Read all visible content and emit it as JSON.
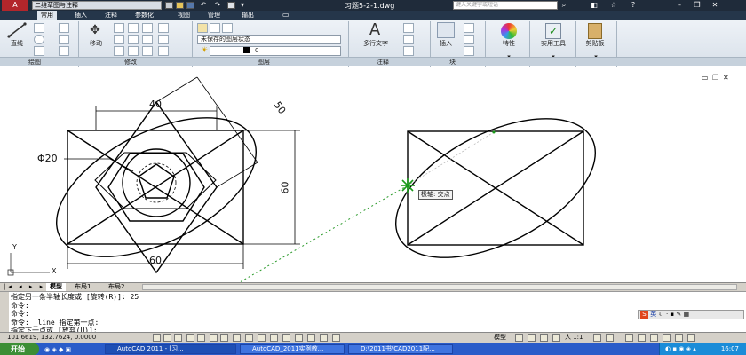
{
  "titlebar": {
    "workspace": "二维草图与注释",
    "document_title": "习题5-2-1.dwg",
    "search_placeholder": "键入关键字或短语"
  },
  "menu": {
    "items": [
      "常用",
      "插入",
      "注释",
      "参数化",
      "视图",
      "管理",
      "输出"
    ],
    "active_index": 0
  },
  "ribbon": {
    "draw": {
      "line_label": "直线",
      "panel_label": "绘图"
    },
    "modify": {
      "move_label": "移动",
      "panel_label": "修改"
    },
    "layers": {
      "layer_state": "未保存的图层状态",
      "current_layer": "0",
      "panel_label": "图层"
    },
    "annotation": {
      "multiline_text_label": "多行文字",
      "panel_label": "注释"
    },
    "block": {
      "insert_label": "插入",
      "panel_label": "块"
    },
    "properties_label": "特性",
    "utilities_label": "实用工具",
    "clipboard_label": "剪贴板"
  },
  "drawing": {
    "dim_top": "40",
    "dim_diagonal": "50",
    "dim_diameter": "Φ20",
    "dim_right": "60",
    "dim_bottom": "60",
    "snap_tooltip": "极轴: 交点",
    "ucs_y": "Y",
    "ucs_x": "X"
  },
  "layout_tabs": [
    "模型",
    "布局1",
    "布局2"
  ],
  "command_lines": [
    "指定另一条半轴长度或 [旋转(R)]: 25",
    "命令:",
    "命令:",
    "命令: _line 指定第一点:",
    "指定下一点或 [放弃(U)]:"
  ],
  "status": {
    "coordinates": "101.6619, 132.7624, 0.0000",
    "model_label": "模型",
    "annotation_scale": "人 1:1"
  },
  "ime": {
    "label": "英"
  },
  "taskbar": {
    "start_label": "开始",
    "tasks": [
      "AutoCAD 2011 - [习...",
      "AutoCAD_2011实例教...",
      "D:\\2011书\\CAD2011配..."
    ],
    "clock": "16:07"
  }
}
